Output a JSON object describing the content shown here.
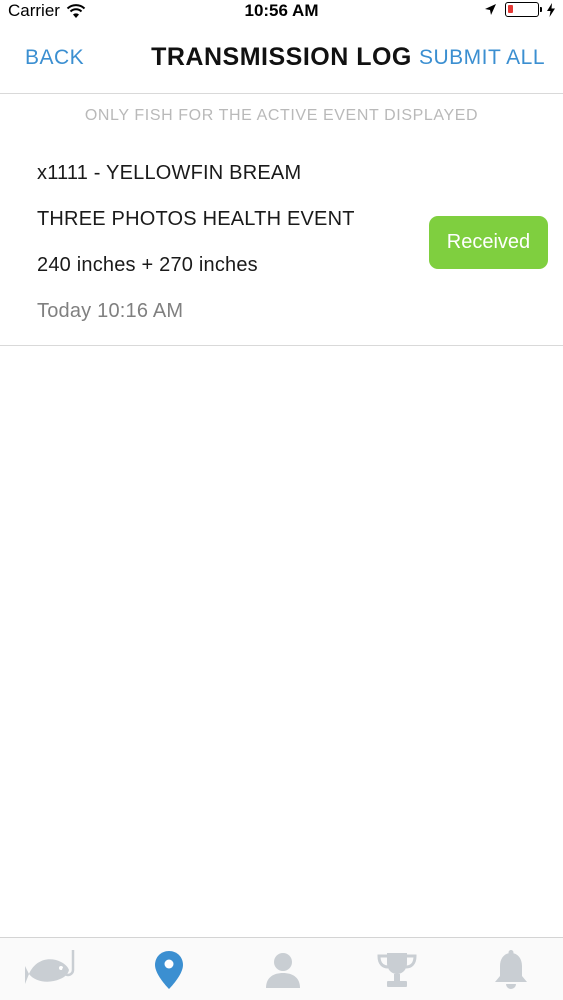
{
  "status_bar": {
    "carrier": "Carrier",
    "time": "10:56 AM",
    "battery_color": "#e53935"
  },
  "nav": {
    "back_label": "BACK",
    "title": "TRANSMISSION LOG",
    "submit_label": "SUBMIT ALL"
  },
  "notice": "ONLY FISH FOR THE ACTIVE EVENT DISPLAYED",
  "log_items": [
    {
      "tag_species": "x1111 - YELLOWFIN BREAM",
      "event": "THREE PHOTOS HEALTH EVENT",
      "measurements": "240 inches + 270 inches",
      "timestamp": "Today 10:16 AM",
      "status": "Received",
      "status_color": "#7fcf3f"
    }
  ],
  "tabs": [
    {
      "icon": "fish-hook-icon",
      "active": false
    },
    {
      "icon": "map-pin-icon",
      "active": true
    },
    {
      "icon": "user-icon",
      "active": false
    },
    {
      "icon": "trophy-icon",
      "active": false
    },
    {
      "icon": "bell-icon",
      "active": false
    }
  ],
  "colors": {
    "accent": "#3b8fd1",
    "inactive_icon": "#c9ced3",
    "divider": "#d9d9d9"
  }
}
